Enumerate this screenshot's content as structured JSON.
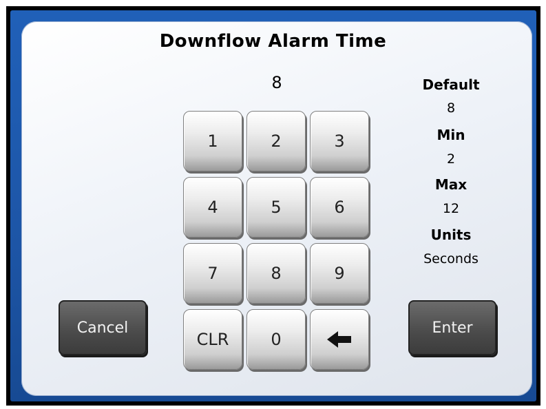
{
  "title": "Downflow Alarm Time",
  "entry_value": "8",
  "info": {
    "default_label": "Default",
    "default_value": "8",
    "min_label": "Min",
    "min_value": "2",
    "max_label": "Max",
    "max_value": "12",
    "units_label": "Units",
    "units_value": "Seconds"
  },
  "keypad": {
    "k1": "1",
    "k2": "2",
    "k3": "3",
    "k4": "4",
    "k5": "5",
    "k6": "6",
    "k7": "7",
    "k8": "8",
    "k9": "9",
    "clr": "CLR",
    "k0": "0",
    "backspace_icon": "left-arrow-icon"
  },
  "buttons": {
    "cancel": "Cancel",
    "enter": "Enter"
  }
}
